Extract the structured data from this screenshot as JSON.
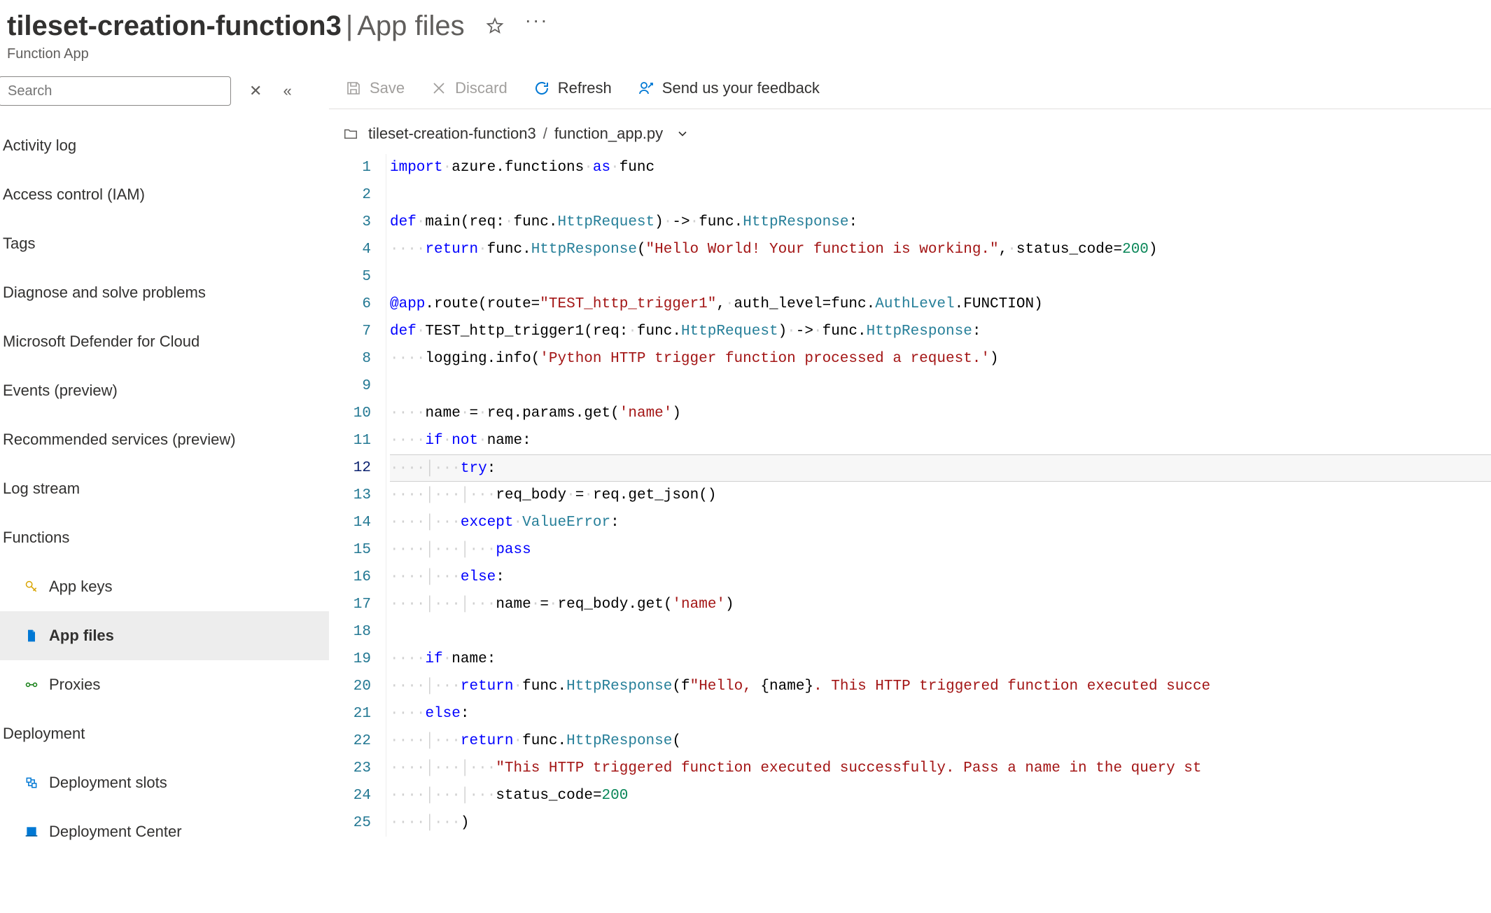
{
  "header": {
    "title": "tileset-creation-function3",
    "separator": "|",
    "subtitle": "App files",
    "resource_type": "Function App"
  },
  "sidebar": {
    "search_placeholder": "Search",
    "items": [
      {
        "label": "Activity log"
      },
      {
        "label": "Access control (IAM)"
      },
      {
        "label": "Tags"
      },
      {
        "label": "Diagnose and solve problems"
      },
      {
        "label": "Microsoft Defender for Cloud"
      },
      {
        "label": "Events (preview)"
      },
      {
        "label": "Recommended services (preview)"
      },
      {
        "label": "Log stream"
      }
    ],
    "functions_header": "Functions",
    "functions_children": [
      {
        "label": "App keys",
        "icon": "key"
      },
      {
        "label": "App files",
        "icon": "doc",
        "selected": true
      },
      {
        "label": "Proxies",
        "icon": "link"
      }
    ],
    "deployment_header": "Deployment",
    "deployment_children": [
      {
        "label": "Deployment slots",
        "icon": "slot"
      },
      {
        "label": "Deployment Center",
        "icon": "center"
      }
    ]
  },
  "toolbar": {
    "save": "Save",
    "discard": "Discard",
    "refresh": "Refresh",
    "feedback": "Send us your feedback"
  },
  "breadcrumb": {
    "folder": "tileset-creation-function3",
    "file": "function_app.py"
  },
  "editor": {
    "current_line": 12,
    "lines": [
      {
        "n": 1,
        "indent": 0,
        "tokens": [
          [
            "kw",
            "import"
          ],
          [
            "sp",
            " "
          ],
          [
            "ident",
            "azure.functions"
          ],
          [
            "sp",
            " "
          ],
          [
            "kw",
            "as"
          ],
          [
            "sp",
            " "
          ],
          [
            "ident",
            "func"
          ]
        ]
      },
      {
        "n": 2,
        "indent": 0,
        "tokens": []
      },
      {
        "n": 3,
        "indent": 0,
        "tokens": [
          [
            "kw",
            "def"
          ],
          [
            "sp",
            " "
          ],
          [
            "ident",
            "main"
          ],
          [
            "op",
            "("
          ],
          [
            "ident",
            "req"
          ],
          [
            "op",
            ":"
          ],
          [
            "sp",
            " "
          ],
          [
            "ident",
            "func"
          ],
          [
            "op",
            "."
          ],
          [
            "fn",
            "HttpRequest"
          ],
          [
            "op",
            ")"
          ],
          [
            "sp",
            " "
          ],
          [
            "op",
            "->"
          ],
          [
            "sp",
            " "
          ],
          [
            "ident",
            "func"
          ],
          [
            "op",
            "."
          ],
          [
            "fn",
            "HttpResponse"
          ],
          [
            "op",
            ":"
          ]
        ]
      },
      {
        "n": 4,
        "indent": 4,
        "tokens": [
          [
            "kw",
            "return"
          ],
          [
            "sp",
            " "
          ],
          [
            "ident",
            "func"
          ],
          [
            "op",
            "."
          ],
          [
            "fn",
            "HttpResponse"
          ],
          [
            "op",
            "("
          ],
          [
            "str",
            "\"Hello World! Your function is working.\""
          ],
          [
            "op",
            ","
          ],
          [
            "sp",
            " "
          ],
          [
            "ident",
            "status_code"
          ],
          [
            "op",
            "="
          ],
          [
            "num",
            "200"
          ],
          [
            "op",
            ")"
          ]
        ]
      },
      {
        "n": 5,
        "indent": 0,
        "tokens": []
      },
      {
        "n": 6,
        "indent": 0,
        "tokens": [
          [
            "dec",
            "@app"
          ],
          [
            "op",
            "."
          ],
          [
            "ident",
            "route"
          ],
          [
            "op",
            "("
          ],
          [
            "ident",
            "route"
          ],
          [
            "op",
            "="
          ],
          [
            "str",
            "\"TEST_http_trigger1\""
          ],
          [
            "op",
            ","
          ],
          [
            "sp",
            " "
          ],
          [
            "ident",
            "auth_level"
          ],
          [
            "op",
            "="
          ],
          [
            "ident",
            "func"
          ],
          [
            "op",
            "."
          ],
          [
            "fn",
            "AuthLevel"
          ],
          [
            "op",
            "."
          ],
          [
            "ident",
            "FUNCTION"
          ],
          [
            "op",
            ")"
          ]
        ]
      },
      {
        "n": 7,
        "indent": 0,
        "tokens": [
          [
            "kw",
            "def"
          ],
          [
            "sp",
            " "
          ],
          [
            "ident",
            "TEST_http_trigger1"
          ],
          [
            "op",
            "("
          ],
          [
            "ident",
            "req"
          ],
          [
            "op",
            ":"
          ],
          [
            "sp",
            " "
          ],
          [
            "ident",
            "func"
          ],
          [
            "op",
            "."
          ],
          [
            "fn",
            "HttpRequest"
          ],
          [
            "op",
            ")"
          ],
          [
            "sp",
            " "
          ],
          [
            "op",
            "->"
          ],
          [
            "sp",
            " "
          ],
          [
            "ident",
            "func"
          ],
          [
            "op",
            "."
          ],
          [
            "fn",
            "HttpResponse"
          ],
          [
            "op",
            ":"
          ]
        ]
      },
      {
        "n": 8,
        "indent": 4,
        "tokens": [
          [
            "ident",
            "logging"
          ],
          [
            "op",
            "."
          ],
          [
            "ident",
            "info"
          ],
          [
            "op",
            "("
          ],
          [
            "str",
            "'Python HTTP trigger function processed a request.'"
          ],
          [
            "op",
            ")"
          ]
        ]
      },
      {
        "n": 9,
        "indent": 0,
        "tokens": []
      },
      {
        "n": 10,
        "indent": 4,
        "tokens": [
          [
            "ident",
            "name"
          ],
          [
            "sp",
            " "
          ],
          [
            "op",
            "="
          ],
          [
            "sp",
            " "
          ],
          [
            "ident",
            "req"
          ],
          [
            "op",
            "."
          ],
          [
            "ident",
            "params"
          ],
          [
            "op",
            "."
          ],
          [
            "ident",
            "get"
          ],
          [
            "op",
            "("
          ],
          [
            "str",
            "'name'"
          ],
          [
            "op",
            ")"
          ]
        ]
      },
      {
        "n": 11,
        "indent": 4,
        "tokens": [
          [
            "kw",
            "if"
          ],
          [
            "sp",
            " "
          ],
          [
            "kw",
            "not"
          ],
          [
            "sp",
            " "
          ],
          [
            "ident",
            "name"
          ],
          [
            "op",
            ":"
          ]
        ]
      },
      {
        "n": 12,
        "indent": 8,
        "tokens": [
          [
            "kw",
            "try"
          ],
          [
            "op",
            ":"
          ]
        ]
      },
      {
        "n": 13,
        "indent": 12,
        "tokens": [
          [
            "ident",
            "req_body"
          ],
          [
            "sp",
            " "
          ],
          [
            "op",
            "="
          ],
          [
            "sp",
            " "
          ],
          [
            "ident",
            "req"
          ],
          [
            "op",
            "."
          ],
          [
            "ident",
            "get_json"
          ],
          [
            "op",
            "()"
          ]
        ]
      },
      {
        "n": 14,
        "indent": 8,
        "tokens": [
          [
            "kw",
            "except"
          ],
          [
            "sp",
            " "
          ],
          [
            "fn",
            "ValueError"
          ],
          [
            "op",
            ":"
          ]
        ]
      },
      {
        "n": 15,
        "indent": 12,
        "tokens": [
          [
            "kw",
            "pass"
          ]
        ]
      },
      {
        "n": 16,
        "indent": 8,
        "tokens": [
          [
            "kw",
            "else"
          ],
          [
            "op",
            ":"
          ]
        ]
      },
      {
        "n": 17,
        "indent": 12,
        "tokens": [
          [
            "ident",
            "name"
          ],
          [
            "sp",
            " "
          ],
          [
            "op",
            "="
          ],
          [
            "sp",
            " "
          ],
          [
            "ident",
            "req_body"
          ],
          [
            "op",
            "."
          ],
          [
            "ident",
            "get"
          ],
          [
            "op",
            "("
          ],
          [
            "str",
            "'name'"
          ],
          [
            "op",
            ")"
          ]
        ]
      },
      {
        "n": 18,
        "indent": 0,
        "tokens": []
      },
      {
        "n": 19,
        "indent": 4,
        "tokens": [
          [
            "kw",
            "if"
          ],
          [
            "sp",
            " "
          ],
          [
            "ident",
            "name"
          ],
          [
            "op",
            ":"
          ]
        ]
      },
      {
        "n": 20,
        "indent": 8,
        "tokens": [
          [
            "kw",
            "return"
          ],
          [
            "sp",
            " "
          ],
          [
            "ident",
            "func"
          ],
          [
            "op",
            "."
          ],
          [
            "fn",
            "HttpResponse"
          ],
          [
            "op",
            "("
          ],
          [
            "ident",
            "f"
          ],
          [
            "str",
            "\"Hello, "
          ],
          [
            "op",
            "{"
          ],
          [
            "ident",
            "name"
          ],
          [
            "op",
            "}"
          ],
          [
            "str",
            ". This HTTP triggered function executed succe"
          ]
        ]
      },
      {
        "n": 21,
        "indent": 4,
        "tokens": [
          [
            "kw",
            "else"
          ],
          [
            "op",
            ":"
          ]
        ]
      },
      {
        "n": 22,
        "indent": 8,
        "tokens": [
          [
            "kw",
            "return"
          ],
          [
            "sp",
            " "
          ],
          [
            "ident",
            "func"
          ],
          [
            "op",
            "."
          ],
          [
            "fn",
            "HttpResponse"
          ],
          [
            "op",
            "("
          ]
        ]
      },
      {
        "n": 23,
        "indent": 12,
        "tokens": [
          [
            "str",
            "\"This HTTP triggered function executed successfully. Pass a name in the query st"
          ]
        ]
      },
      {
        "n": 24,
        "indent": 12,
        "tokens": [
          [
            "ident",
            "status_code"
          ],
          [
            "op",
            "="
          ],
          [
            "num",
            "200"
          ]
        ]
      },
      {
        "n": 25,
        "indent": 8,
        "tokens": [
          [
            "op",
            ")"
          ]
        ]
      }
    ]
  }
}
